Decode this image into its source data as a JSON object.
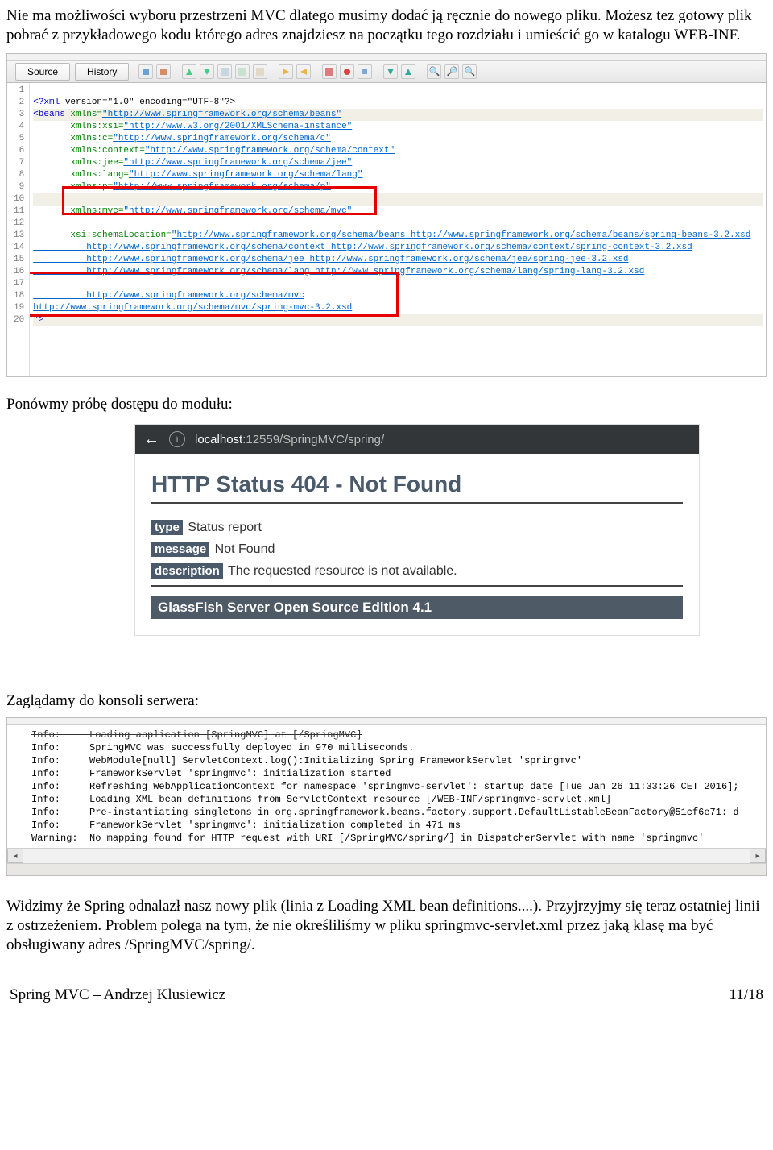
{
  "para1": "Nie ma możliwości wyboru przestrzeni MVC dlatego musimy dodać ją ręcznie do nowego pliku. Możesz tez gotowy plik pobrać z przykładowego kodu  którego adres znajdziesz na początku tego rozdziału i umieścić go w katalogu WEB-INF.",
  "ide": {
    "tab_source": "Source",
    "tab_history": "History",
    "gutter": [
      "1",
      "2",
      "3",
      "4",
      "5",
      "6",
      "7",
      "8",
      "9",
      "10",
      "11",
      "12",
      "13",
      "14",
      "15",
      "16",
      "17",
      "18",
      "19",
      "20"
    ],
    "line1_tag": "<?xml",
    "line1_rest": " version=\"1.0\" encoding=\"UTF-8\"?>",
    "line2_tag": "<beans",
    "line2_attr": " xmlns=",
    "line2_url": "\"http://www.springframework.org/schema/beans\"",
    "line3_attr": "       xmlns:xsi=",
    "line3_url": "\"http://www.w3.org/2001/XMLSchema-instance\"",
    "line4_attr": "       xmlns:c=",
    "line4_url": "\"http://www.springframework.org/schema/c\"",
    "line5_attr": "       xmlns:context=",
    "line5_url": "\"http://www.springframework.org/schema/context\"",
    "line6_attr": "       xmlns:jee=",
    "line6_url": "\"http://www.springframework.org/schema/jee\"",
    "line7_attr": "       xmlns:lang=",
    "line7_url": "\"http://www.springframework.org/schema/lang\"",
    "line8_attr": "       xmlns:p=",
    "line8_url": "\"http://www.springframework.org/schema/p\"",
    "line10_attr": "       xmlns:mvc=",
    "line10_url": "\"http://www.springframework.org/schema/mvc\"",
    "line12_attr": "       xsi:schemaLocation=",
    "line12_u1": "\"http://www.springframework.org/schema/beans",
    "line12_u2": " http://www.springframework.org/schema/beans/spring-beans-3.2.xsd",
    "line13_u1": "          http://www.springframework.org/schema/context",
    "line13_u2": " http://www.springframework.org/schema/context/spring-context-3.2.xsd",
    "line14_u1": "          http://www.springframework.org/schema/jee",
    "line14_u2": " http://www.springframework.org/schema/jee/spring-jee-3.2.xsd",
    "line15_u1": "          http://www.springframework.org/schema/lang",
    "line15_u2": " http://www.springframework.org/schema/lang/spring-lang-3.2.xsd",
    "line17_u1": "          http://www.springframework.org/schema/mvc",
    "line18_u1": "http://www.springframework.org/schema/mvc/spring-mvc-3.2.xsd",
    "line19_tag": "\">"
  },
  "para2": "Ponówmy próbę dostępu do modułu:",
  "browser": {
    "url_host": "localhost",
    "url_rest": ":12559/SpringMVC/spring/",
    "h404": "HTTP Status 404 - Not Found",
    "type_label": "type",
    "type_value": " Status report",
    "message_label": "message",
    "message_value": " Not Found",
    "description_label": "description",
    "description_value": " The requested resource is not available.",
    "glassfish": "GlassFish Server Open Source Edition 4.1"
  },
  "para3": "Zaglądamy do konsoli serwera:",
  "console_lines": [
    {
      "level": "Info:",
      "msg": "Loading application [SpringMVC] at [/SpringMVC]",
      "strike": true
    },
    {
      "level": "Info:",
      "msg": "SpringMVC was successfully deployed in 970 milliseconds."
    },
    {
      "level": "Info:",
      "msg": "WebModule[null] ServletContext.log():Initializing Spring FrameworkServlet 'springmvc'"
    },
    {
      "level": "Info:",
      "msg": "FrameworkServlet 'springmvc': initialization started"
    },
    {
      "level": "Info:",
      "msg": "Refreshing WebApplicationContext for namespace 'springmvc-servlet': startup date [Tue Jan 26 11:33:26 CET 2016];"
    },
    {
      "level": "Info:",
      "msg": "Loading XML bean definitions from ServletContext resource [/WEB-INF/springmvc-servlet.xml]"
    },
    {
      "level": "Info:",
      "msg": "Pre-instantiating singletons in org.springframework.beans.factory.support.DefaultListableBeanFactory@51cf6e71: d"
    },
    {
      "level": "Info:",
      "msg": "FrameworkServlet 'springmvc': initialization completed in 471 ms"
    },
    {
      "level": "Warning:",
      "msg": "No mapping found for HTTP request with URI [/SpringMVC/spring/] in DispatcherServlet with name 'springmvc'"
    }
  ],
  "para4": "Widzimy że Spring odnalazł nasz nowy plik (linia z Loading XML bean definitions....). Przyjrzyjmy się teraz ostatniej linii z ostrzeżeniem. Problem polega na tym, że nie określiliśmy w pliku springmvc-servlet.xml przez jaką klasę ma być obsługiwany adres /SpringMVC/spring/.",
  "footer_left": "Spring MVC – Andrzej Klusiewicz",
  "footer_right": "11/18"
}
